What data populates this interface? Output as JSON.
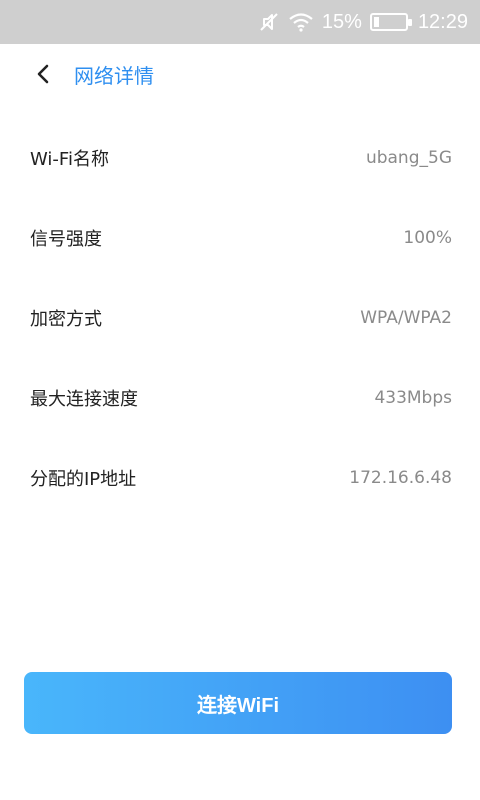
{
  "status_bar": {
    "signal_icon": "sound-off-icon",
    "wifi_icon": "wifi-icon",
    "battery_percent": "15%",
    "battery_level": 0.15,
    "time": "12:29"
  },
  "nav": {
    "back_icon": "chevron-left-icon",
    "title": "网络详情",
    "title_color": "#2f8ff0"
  },
  "details": [
    {
      "label": "Wi-Fi名称",
      "value": "ubang_5G"
    },
    {
      "label": "信号强度",
      "value": "100%"
    },
    {
      "label": "加密方式",
      "value": "WPA/WPA2"
    },
    {
      "label": "最大连接速度",
      "value": "433Mbps"
    },
    {
      "label": "分配的IP地址",
      "value": "172.16.6.48"
    }
  ],
  "connect_button": {
    "label": "连接WiFi",
    "gradient_start": "#49b6fb",
    "gradient_end": "#3d8ff2"
  }
}
